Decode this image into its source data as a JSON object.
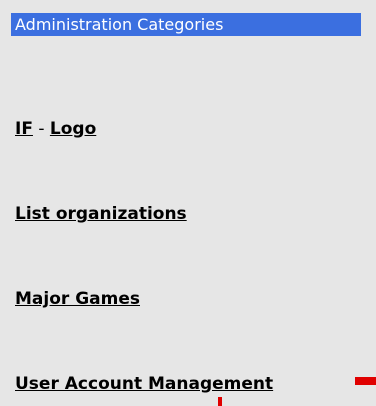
{
  "panel": {
    "title": "Administration Categories"
  },
  "links": {
    "if_label": "IF",
    "separator": "-",
    "logo_label": "Logo",
    "list_organizations": "List organizations",
    "major_games": "Major Games",
    "user_account_management": "User Account Management"
  },
  "colors": {
    "header_bg": "#3b6fe0",
    "page_bg": "#e6e6e6",
    "marker": "#e00000"
  }
}
